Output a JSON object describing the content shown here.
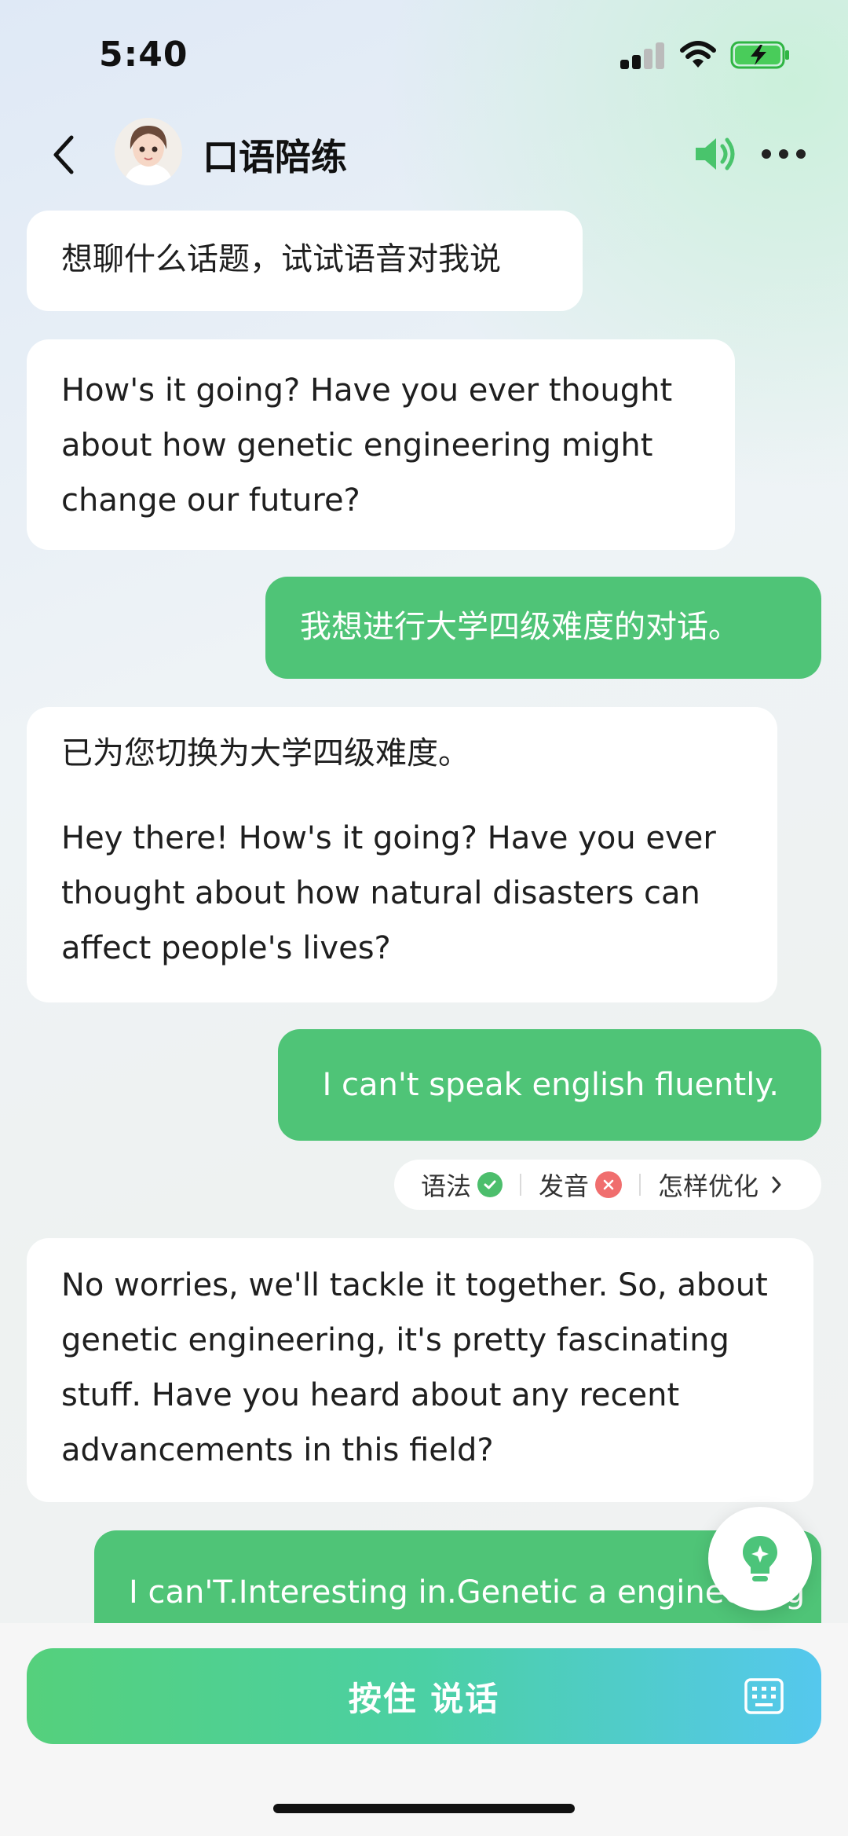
{
  "status_bar": {
    "time": "5:40"
  },
  "header": {
    "title": "口语陪练",
    "back_icon": "chevron-left-icon",
    "speaker_icon": "speaker-icon",
    "more_icon": "more-dots-icon"
  },
  "messages": [
    {
      "role": "bot",
      "paragraphs": [
        "想聊什么话题，试试语音对我说"
      ]
    },
    {
      "role": "bot",
      "paragraphs": [
        "How's it going? Have you ever thought about how genetic engineering might change our future?"
      ]
    },
    {
      "role": "user",
      "paragraphs": [
        "我想进行大学四级难度的对话。"
      ]
    },
    {
      "role": "bot",
      "paragraphs": [
        "已为您切换为大学四级难度。",
        "Hey there! How's it going? Have you ever thought about how natural disasters can affect people's lives?"
      ]
    },
    {
      "role": "user",
      "paragraphs": [
        "I can't speak english fluently."
      ]
    },
    {
      "role": "bot",
      "paragraphs": [
        "No worries, we'll tackle it together. So, about genetic engineering, it's pretty fascinating stuff. Have you heard about any recent advancements in this field?"
      ]
    },
    {
      "role": "user",
      "paragraphs": [
        "I can'T.Interesting in.Genetic a engineering"
      ]
    }
  ],
  "feedback": {
    "grammar_label": "语法",
    "grammar_status": "ok",
    "pronunciation_label": "发音",
    "pronunciation_status": "error",
    "optimize_label": "怎样优化"
  },
  "hint_button": {
    "icon": "lightbulb-icon"
  },
  "bottom": {
    "talk_label": "按住 说话",
    "keyboard_icon": "keyboard-icon"
  },
  "colors": {
    "accent_green": "#4fc477",
    "bot_bubble": "#ffffff",
    "error_red": "#f06e6e",
    "ok_green": "#4cbe6c"
  }
}
